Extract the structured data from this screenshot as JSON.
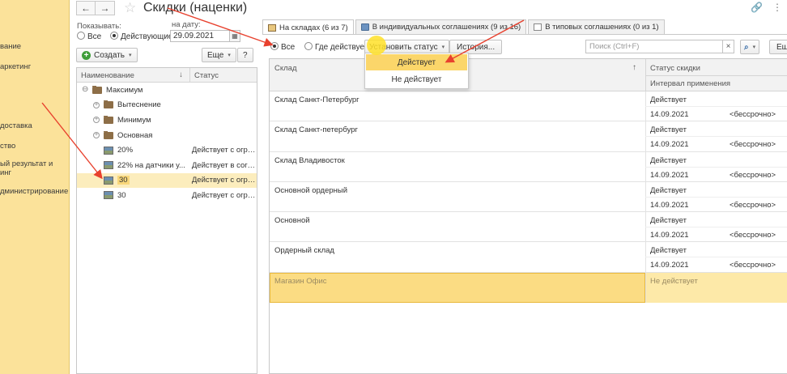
{
  "sidebar": {
    "items": [
      "вание",
      "аркетинг",
      "доставка",
      "ство",
      "ый результат и",
      "инг",
      "дминистрирование"
    ]
  },
  "header": {
    "back": "←",
    "forward": "→",
    "title": "Скидки (наценки)",
    "link_icon": "🔗",
    "more_icon": "⋮"
  },
  "filter": {
    "show_label": "Показывать:",
    "option_all": "Все",
    "option_active": "Действующие",
    "date_label": "на дату:",
    "date_value": "29.09.2021"
  },
  "left_toolbar": {
    "create": "Создать",
    "more": "Еще",
    "help": "?"
  },
  "left_table": {
    "col_name": "Наименование",
    "col_status": "Статус",
    "sort_arrow": "↓",
    "rows": [
      {
        "name": "Максимум",
        "status": ""
      },
      {
        "name": "Вытеснение",
        "status": ""
      },
      {
        "name": "Минимум",
        "status": ""
      },
      {
        "name": "Основная",
        "status": ""
      },
      {
        "name": "20%",
        "status": "Действует с огран..."
      },
      {
        "name": "22% на датчики у...",
        "status": "Действует в согла..."
      },
      {
        "name": "30",
        "status": "Действует с огран..."
      },
      {
        "name": "30",
        "status": "Действует с огран..."
      }
    ]
  },
  "tabs": [
    {
      "label": "На складах (6 из 7)"
    },
    {
      "label": "В индивидуальных соглашениях (9 из 16)"
    },
    {
      "label": "В типовых соглашениях (0 из 1)"
    }
  ],
  "right_toolbar": {
    "option_all": "Все",
    "option_where": "Где действует",
    "set_status": "Установить статус",
    "history": "История...",
    "search_placeholder": "Поиск (Ctrl+F)",
    "clear": "×",
    "search_btn": "🔍",
    "more": "Еще"
  },
  "dropdown": {
    "items": [
      "Действует",
      "Не действует"
    ]
  },
  "right_table": {
    "col_warehouse": "Склад",
    "sort_arrow": "↑",
    "col_status": "Статус скидки",
    "col_interval": "Интервал применения",
    "rows": [
      {
        "warehouse": "Склад Санкт-Петербург",
        "status": "Действует",
        "date": "14.09.2021",
        "end": "<бессрочно>"
      },
      {
        "warehouse": "Склад Санкт-петербург",
        "status": "Действует",
        "date": "14.09.2021",
        "end": "<бессрочно>"
      },
      {
        "warehouse": "Склад Владивосток",
        "status": "Действует",
        "date": "14.09.2021",
        "end": "<бессрочно>"
      },
      {
        "warehouse": "Основной ордерный",
        "status": "Действует",
        "date": "14.09.2021",
        "end": "<бессрочно>"
      },
      {
        "warehouse": "Основной",
        "status": "Действует",
        "date": "14.09.2021",
        "end": "<бессрочно>"
      },
      {
        "warehouse": "Ордерный склад",
        "status": "Действует",
        "date": "14.09.2021",
        "end": "<бессрочно>"
      },
      {
        "warehouse": "Магазин Офис",
        "status": "Не действует",
        "date": "",
        "end": ""
      }
    ]
  },
  "colors": {
    "sidebar": "#fbe29a",
    "selection": "#fbdc83",
    "annotation": "#e8412e",
    "create_icon": "#3f9d3a"
  }
}
